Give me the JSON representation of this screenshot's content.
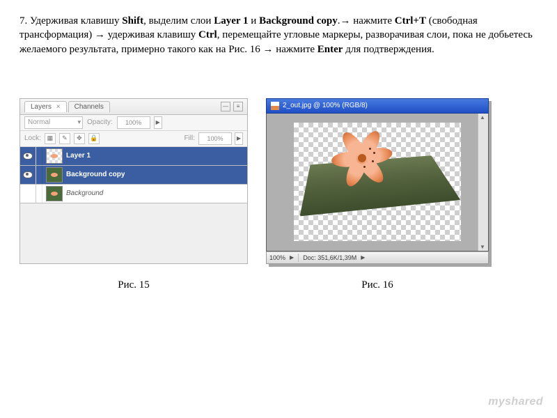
{
  "paragraph": {
    "start": "7. Удерживая клавишу ",
    "shift": "Shift",
    "t1": ", выделим слои ",
    "l1": "Layer 1",
    "t2": " и ",
    "l2": "Background copy",
    "t3": ".→ нажмите  ",
    "ctrlt": "Ctrl+T",
    "t4": " (свободная трансформация) → удерживая клавишу ",
    "ctrl": "Ctrl",
    "t5": ", перемещайте угловые маркеры, разворачивая слои, пока не добьетесь желаемого результата, примерно такого как на Рис. 16 → нажмите ",
    "enter": "Enter",
    "t6": " для подтверждения."
  },
  "fig15": {
    "tabs": {
      "layers": "Layers",
      "channels": "Channels",
      "close": "×",
      "minimize": "—",
      "menu": "≡"
    },
    "opts": {
      "mode": "Normal",
      "opacity_lbl": "Opacity:",
      "opacity_val": "100%"
    },
    "lock": {
      "lbl": "Lock:",
      "fill_lbl": "Fill:",
      "fill_val": "100%",
      "ico_transp": "▦",
      "ico_brush": "✎",
      "ico_move": "✥",
      "ico_lock": "🔒"
    },
    "layers": {
      "l1": "Layer 1",
      "bgcopy": "Background copy",
      "bg": "Background"
    }
  },
  "fig16": {
    "title": "2_out.jpg @ 100% (RGB/8)",
    "status": {
      "zoom": "100%",
      "doc": "Doc: 351,6K/1,39M",
      "arrow": "▶"
    }
  },
  "captions": {
    "c1": "Рис. 15",
    "c2": "Рис. 16"
  },
  "watermark": "myshared"
}
